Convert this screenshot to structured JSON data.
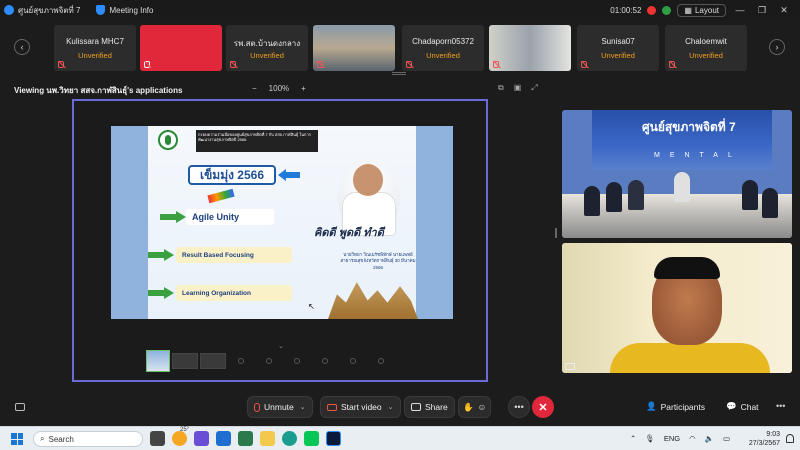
{
  "titlebar": {
    "app_title": "ศูนย์สุขภาพจิตที่ 7",
    "meeting_info": "Meeting Info",
    "timer": "01:00:52",
    "layout_label": "Layout",
    "minimize": "—",
    "maximize": "❐",
    "close": "✕"
  },
  "participants": [
    {
      "name": "Kulissara MHC7",
      "status": "Unverified",
      "kind": "text"
    },
    {
      "name": "",
      "status": "",
      "kind": "red"
    },
    {
      "name": "รพ.สต.บ้านดงกลาง",
      "status": "Unverified",
      "kind": "text"
    },
    {
      "name": "",
      "status": "",
      "kind": "photo"
    },
    {
      "name": "Chadaporn05372",
      "status": "Unverified",
      "kind": "text"
    },
    {
      "name": "",
      "status": "",
      "kind": "photo2"
    },
    {
      "name": "Sunisa07",
      "status": "Unverified",
      "kind": "text"
    },
    {
      "name": "Chaloemwit",
      "status": "Unverified",
      "kind": "text"
    }
  ],
  "viewbar": {
    "viewing_label": "Viewing นพ.วิทยา สสจ.กาฬสินธุ์'s applications",
    "zoom_minus": "−",
    "zoom_value": "100%",
    "zoom_plus": "+"
  },
  "slide": {
    "banner": "กรอบความร่วมมือของศูนย์สุขภาพจิตที่ 7 กับ สสจ.กาฬสินธุ์ ในการพัฒนางานสุขภาพจิตปี 2566",
    "title": "เข็มมุ่ง 2566",
    "item1": "Agile Unity",
    "item2": "Result Based Focusing",
    "item3": "Learning Organization",
    "slogan": "คิดดี พูดดี ทำดี",
    "caption": "นายวิทยา วิณเมรัชพิทักษ์ นายแพทย์สาธารณสุขจังหวัดกาฬสินธุ์ 30 มีนาคม 2566",
    "cursor": "↖"
  },
  "video1": {
    "wall_title": "ศูนย์สุขภาพจิตที่ 7",
    "wall_word": "MENTAL"
  },
  "toolbar": {
    "unmute": "Unmute",
    "start_video": "Start video",
    "share": "Share",
    "more": "•••",
    "leave": "✕",
    "participants": "Participants",
    "chat": "Chat",
    "more_right": "•••"
  },
  "taskbar": {
    "search": "Search",
    "weather": "25°",
    "lang": "ENG",
    "time": "9:03",
    "date": "27/3/2567"
  },
  "colors": {
    "accent": "#2d8cff",
    "unverified": "#f0a020",
    "leave": "#e0283a",
    "share_border": "#6b6bd8"
  }
}
